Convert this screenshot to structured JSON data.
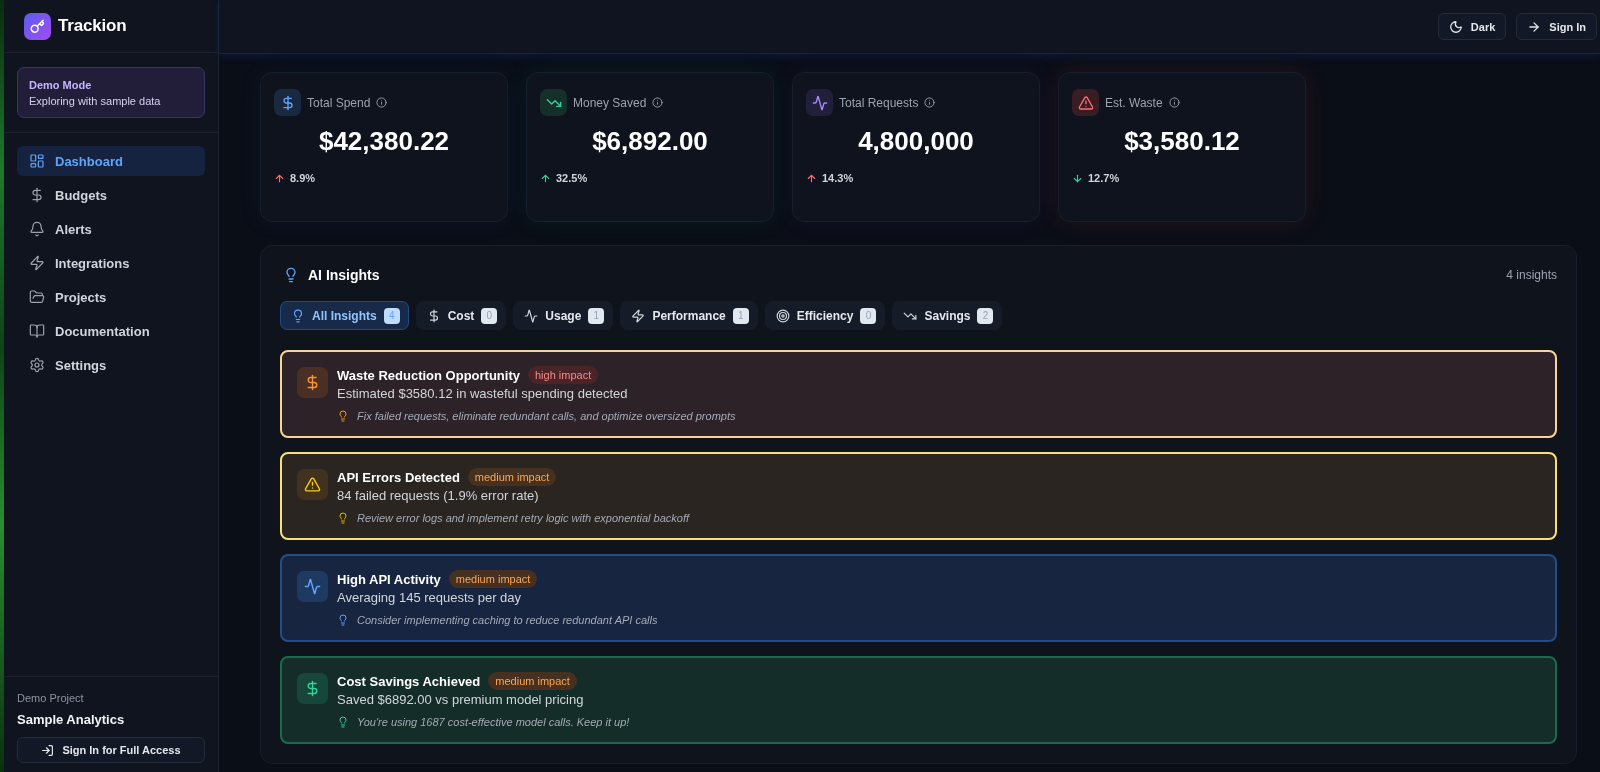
{
  "sidebar": {
    "brand": "Trackion",
    "demo_banner": {
      "title": "Demo Mode",
      "text": "Exploring with sample data"
    },
    "nav": [
      {
        "kind": "dashboard",
        "label": "Dashboard",
        "selected": true
      },
      {
        "kind": "budgets",
        "label": "Budgets",
        "selected": false
      },
      {
        "kind": "alerts",
        "label": "Alerts",
        "selected": false
      },
      {
        "kind": "integrations",
        "label": "Integrations",
        "selected": false
      },
      {
        "kind": "projects",
        "label": "Projects",
        "selected": false
      },
      {
        "kind": "documentation",
        "label": "Documentation",
        "selected": false
      },
      {
        "kind": "settings",
        "label": "Settings",
        "selected": false
      }
    ],
    "footer": {
      "caption": "Demo Project",
      "project": "Sample Analytics",
      "button": "Sign In for Full Access"
    }
  },
  "topbar": {
    "buttons": [
      {
        "kind": "theme",
        "label": "Dark"
      },
      {
        "kind": "signin",
        "label": "Sign In"
      }
    ]
  },
  "stats": [
    {
      "kind": "spend",
      "title": "Total Spend",
      "value": "$42,380.22",
      "change": "8.9%",
      "rising": true,
      "favorable": false
    },
    {
      "kind": "saved",
      "title": "Money Saved",
      "value": "$6,892.00",
      "change": "32.5%",
      "rising": true,
      "favorable": true
    },
    {
      "kind": "requests",
      "title": "Total Requests",
      "value": "4,800,000",
      "change": "14.3%",
      "rising": true,
      "favorable": false
    },
    {
      "kind": "waste",
      "title": "Est. Waste",
      "value": "$3,580.12",
      "change": "12.7%",
      "rising": false,
      "favorable": true
    }
  ],
  "insights": {
    "title": "AI Insights",
    "summary": "4 insights",
    "tabs": [
      {
        "kind": "all",
        "label": "All Insights",
        "count": "4",
        "selected": true
      },
      {
        "kind": "cost",
        "label": "Cost",
        "count": "0",
        "selected": false
      },
      {
        "kind": "usage",
        "label": "Usage",
        "count": "1",
        "selected": false
      },
      {
        "kind": "performance",
        "label": "Performance",
        "count": "1",
        "selected": false
      },
      {
        "kind": "efficiency",
        "label": "Efficiency",
        "count": "0",
        "selected": false
      },
      {
        "kind": "savings",
        "label": "Savings",
        "count": "2",
        "selected": false
      }
    ],
    "items": [
      {
        "kind": "waste",
        "title": "Waste Reduction Opportunity",
        "high_impact": true,
        "badge": "high impact",
        "description": "Estimated $3580.12 in wasteful spending detected",
        "tip": "Fix failed requests, eliminate redundant calls, and optimize oversized prompts"
      },
      {
        "kind": "error",
        "title": "API Errors Detected",
        "high_impact": false,
        "badge": "medium impact",
        "description": "84 failed requests (1.9% error rate)",
        "tip": "Review error logs and implement retry logic with exponential backoff"
      },
      {
        "kind": "activity",
        "title": "High API Activity",
        "high_impact": false,
        "badge": "medium impact",
        "description": "Averaging 145 requests per day",
        "tip": "Consider implementing caching to reduce redundant API calls"
      },
      {
        "kind": "savings",
        "title": "Cost Savings Achieved",
        "high_impact": false,
        "badge": "medium impact",
        "description": "Saved $6892.00 vs premium model pricing",
        "tip": "You're using 1687 cost-effective model calls. Keep it up!"
      }
    ]
  }
}
